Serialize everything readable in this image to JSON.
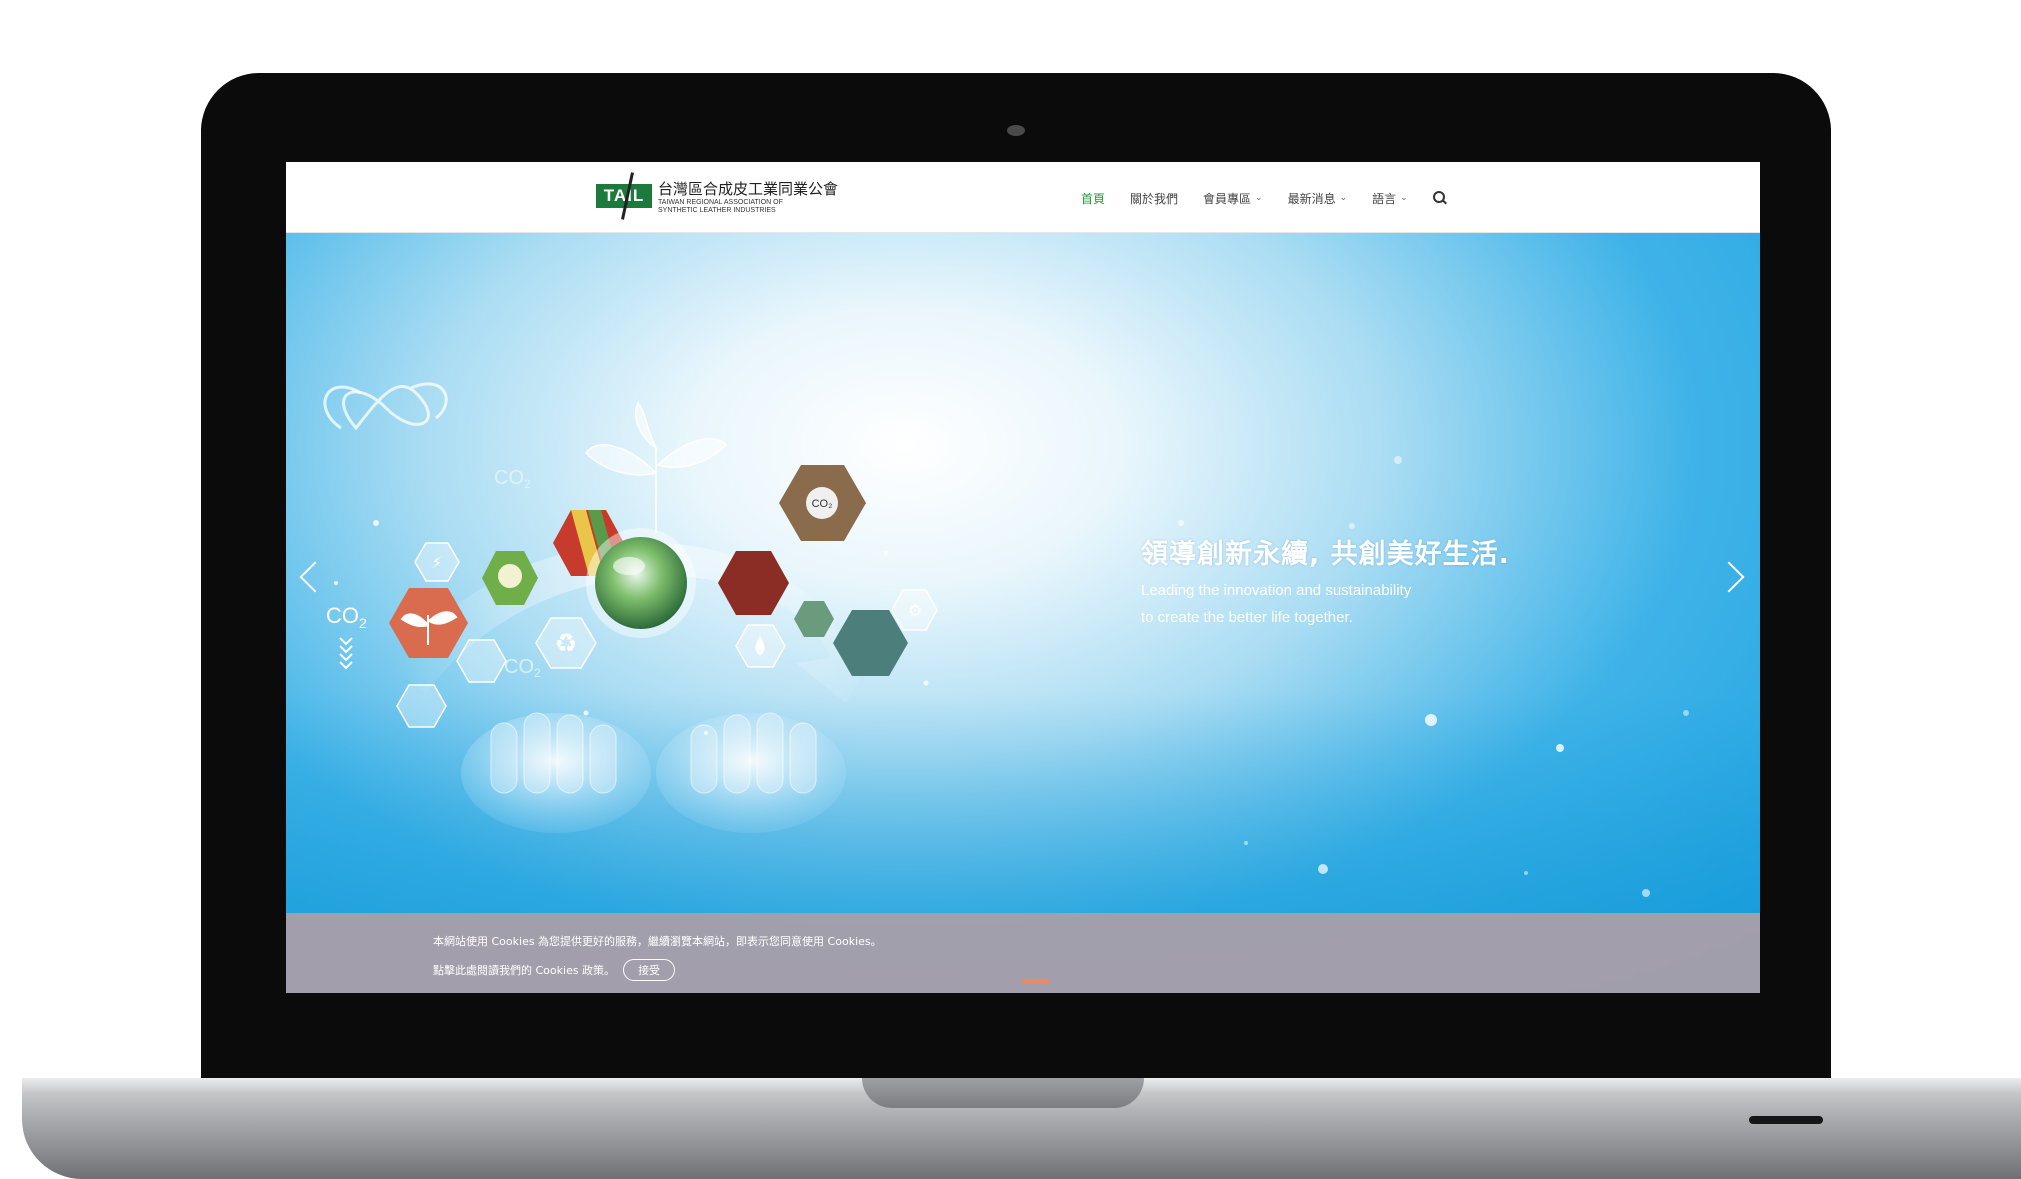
{
  "site": {
    "logo": {
      "mark": "TAIL",
      "name_cn": "台灣區合成皮工業同業公會",
      "name_en_line1": "TAIWAN REGIONAL ASSOCIATION OF",
      "name_en_line2": "SYNTHETIC LEATHER INDUSTRIES"
    },
    "nav": {
      "items": [
        {
          "label": "首頁",
          "active": true,
          "dropdown": false
        },
        {
          "label": "關於我們",
          "active": false,
          "dropdown": false
        },
        {
          "label": "會員專區",
          "active": false,
          "dropdown": true
        },
        {
          "label": "最新消息",
          "active": false,
          "dropdown": true
        },
        {
          "label": "語言",
          "active": false,
          "dropdown": true
        }
      ],
      "search_icon": "search-icon",
      "active_color": "#1f9d39"
    },
    "hero": {
      "title": "領導創新永續, 共創美好生活.",
      "subtitle_line1": "Leading the innovation and sustainability",
      "subtitle_line2": "to create the better life together.",
      "co2_label": "CO",
      "co2_sub": "2",
      "prev_icon": "chevron-left-icon",
      "next_icon": "chevron-right-icon"
    },
    "cookie": {
      "line1": "本網站使用 Cookies 為您提供更好的服務，繼續瀏覽本網站，即表示您同意使用 Cookies。",
      "line2": "點擊此處閱讀我們的 Cookies 政策。",
      "accept": "接受"
    }
  },
  "colors": {
    "hero_blue": "#1a9fdf",
    "cookie_bg": "#a89eaa",
    "brand_green": "#1c7a3c"
  }
}
